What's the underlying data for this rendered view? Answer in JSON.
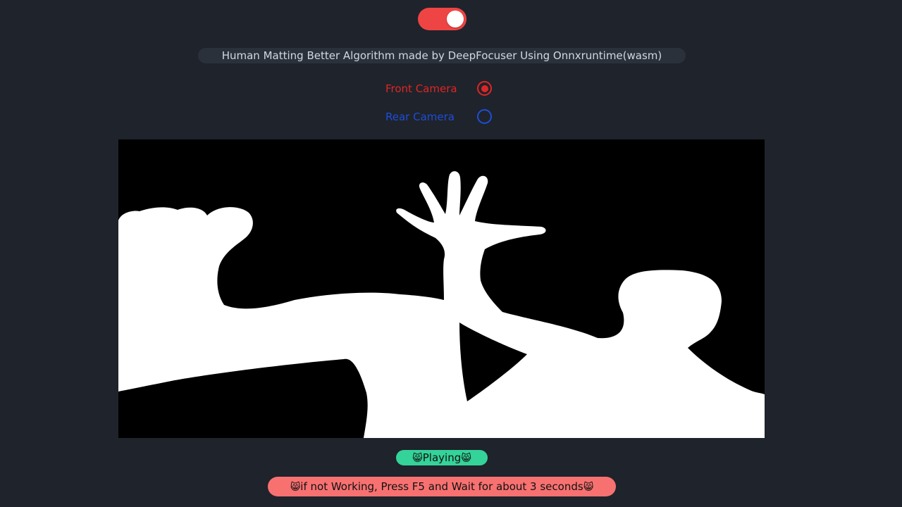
{
  "toggle": {
    "state": "on",
    "accent_color": "#ef4444"
  },
  "subtitle": "Human Matting Better Algorithm made by DeepFocuser Using Onnxruntime(wasm)",
  "cameras": [
    {
      "label": "Front Camera",
      "selected": true,
      "color": "#dc2626"
    },
    {
      "label": "Rear Camera",
      "selected": false,
      "color": "#1d4ed8"
    }
  ],
  "status": {
    "emoji": "😸",
    "text": "Playing",
    "color": "#34d399"
  },
  "warning": {
    "emoji": "😸",
    "text": "if not Working, Press F5 and Wait for about 3 seconds",
    "color": "#f87171"
  }
}
